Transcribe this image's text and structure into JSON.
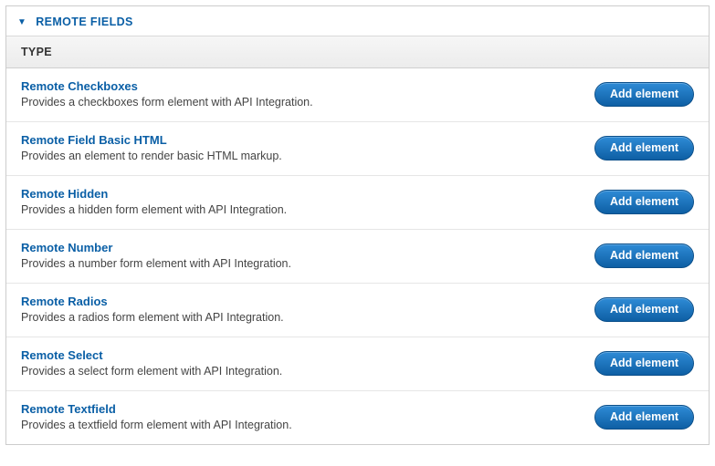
{
  "section": {
    "title": "REMOTE FIELDS",
    "column_header": "TYPE",
    "add_button_label": "Add element",
    "items": [
      {
        "title": "Remote Checkboxes",
        "desc": "Provides a checkboxes form element with API Integration."
      },
      {
        "title": "Remote Field Basic HTML",
        "desc": "Provides an element to render basic HTML markup."
      },
      {
        "title": "Remote Hidden",
        "desc": "Provides a hidden form element with API Integration."
      },
      {
        "title": "Remote Number",
        "desc": "Provides a number form element with API Integration."
      },
      {
        "title": "Remote Radios",
        "desc": "Provides a radios form element with API Integration."
      },
      {
        "title": "Remote Select",
        "desc": "Provides a select form element with API Integration."
      },
      {
        "title": "Remote Textfield",
        "desc": "Provides a textfield form element with API Integration."
      }
    ]
  }
}
